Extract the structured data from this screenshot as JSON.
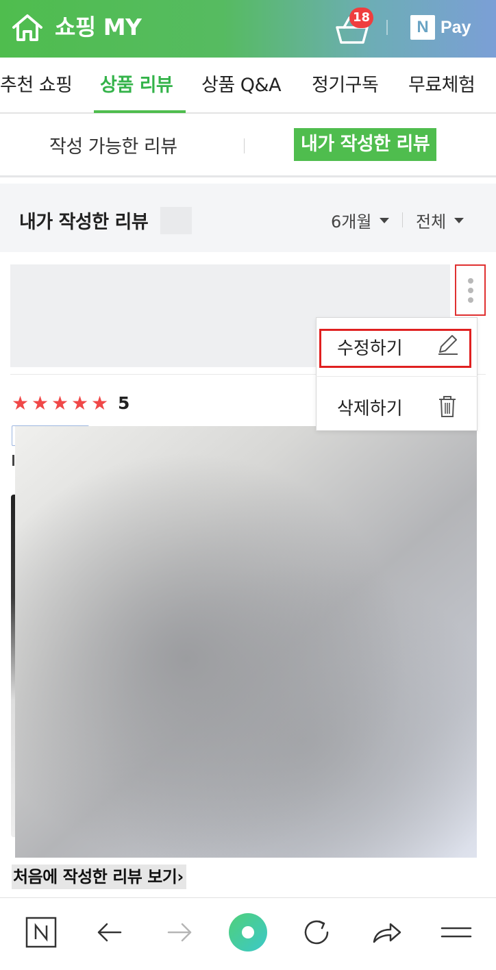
{
  "header": {
    "title": "쇼핑 MY",
    "home_icon": "home-icon",
    "cart_icon": "shopping-basket-icon",
    "cart_count": "18",
    "npay_logo": "N",
    "npay_label": "Pay",
    "accent": "#4fbd4e"
  },
  "tabs": [
    {
      "label": "추천 쇼핑"
    },
    {
      "label": "상품 리뷰"
    },
    {
      "label": "상품 Q&A"
    },
    {
      "label": "정기구독"
    },
    {
      "label": "무료체험"
    }
  ],
  "subtabs": {
    "left": "작성 가능한 리뷰",
    "right": "내가 작성한 리뷰"
  },
  "section": {
    "title": "내가 작성한 리뷰",
    "filter_period": "6개월",
    "filter_type": "전체"
  },
  "review": {
    "rating": "5",
    "stars": 5,
    "star_glyph": "★",
    "menu": {
      "edit": "수정하기",
      "delete": "삭제하기"
    },
    "first_review_link": "처음에 작성한 리뷰 보기",
    "link_chevron": "›"
  },
  "bottom_bar": {
    "icons": [
      "naver-n-icon",
      "back-arrow-icon",
      "forward-arrow-icon",
      "green-dot-home-icon",
      "refresh-icon",
      "share-icon",
      "menu-icon"
    ]
  },
  "colors": {
    "star": "#f04848",
    "highlight_border": "#e02020"
  }
}
